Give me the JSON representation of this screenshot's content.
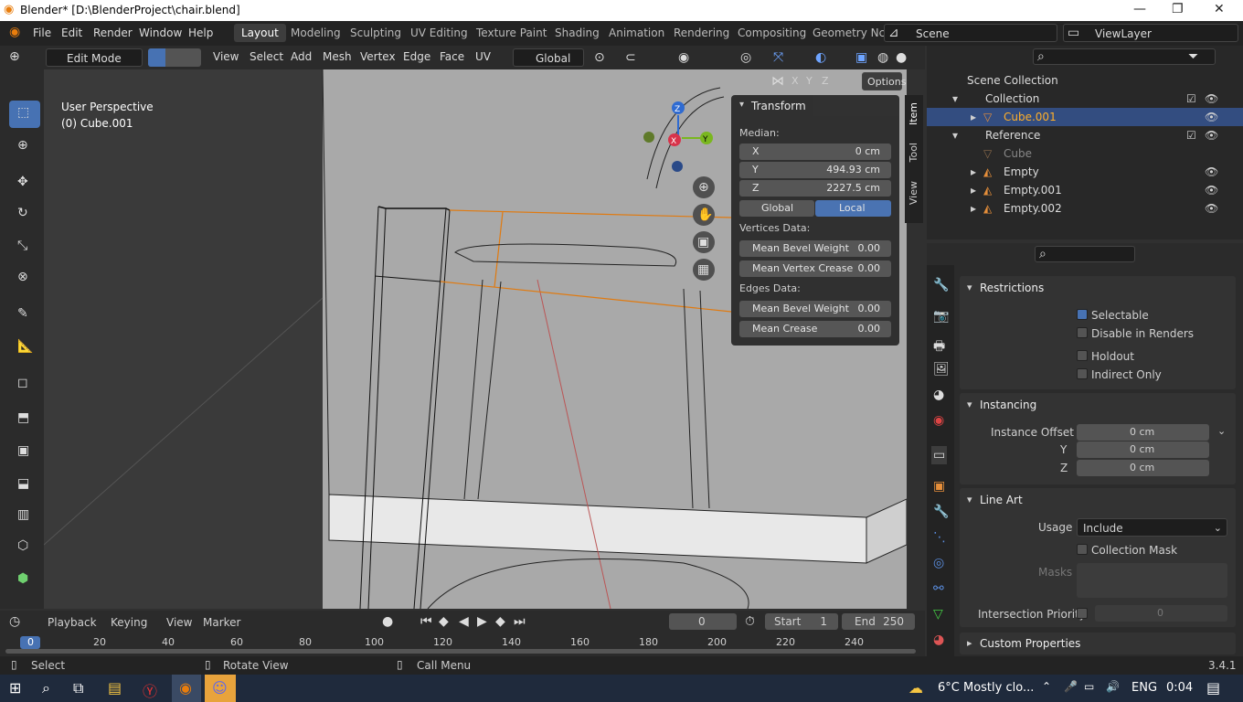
{
  "window": {
    "title": "Blender* [D:\\BlenderProject\\chair.blend]",
    "min": "—",
    "max": "❐",
    "close": "✕"
  },
  "menu": [
    "File",
    "Edit",
    "Render",
    "Window",
    "Help"
  ],
  "workspaces": [
    "Layout",
    "Modeling",
    "Sculpting",
    "UV Editing",
    "Texture Paint",
    "Shading",
    "Animation",
    "Rendering",
    "Compositing",
    "Geometry Nc"
  ],
  "scene": {
    "name": "Scene",
    "view_layer": "ViewLayer"
  },
  "header3d": {
    "mode": "Edit Mode",
    "menus": [
      "View",
      "Select",
      "Add",
      "Mesh",
      "Vertex",
      "Edge",
      "Face",
      "UV"
    ],
    "orientation": "Global",
    "axes": [
      "X",
      "Y",
      "Z"
    ],
    "options": "Options"
  },
  "viewport": {
    "perspective": "User Perspective",
    "object": "(0) Cube.001"
  },
  "gizmo": {
    "z": "Z",
    "x": "X",
    "y": "Y"
  },
  "npanel": {
    "title": "Transform",
    "median_label": "Median:",
    "x_label": "X",
    "x_value": "0 cm",
    "y_label": "Y",
    "y_value": "494.93 cm",
    "z_label": "Z",
    "z_value": "2227.5 cm",
    "global": "Global",
    "local": "Local",
    "vertices_label": "Vertices Data:",
    "mean_bevel_weight": "Mean Bevel Weight",
    "mbw_value": "0.00",
    "mean_vertex_crease": "Mean Vertex Crease",
    "mvc_value": "0.00",
    "edges_label": "Edges Data:",
    "mean_bevel_weight_e": "Mean Bevel Weight",
    "mbwe_value": "0.00",
    "mean_crease": "Mean Crease",
    "mc_value": "0.00",
    "tabs": [
      "Item",
      "Tool",
      "View"
    ]
  },
  "outliner": {
    "rows": [
      {
        "label": "Scene Collection"
      },
      {
        "label": "Collection"
      },
      {
        "label": "Cube.001"
      },
      {
        "label": "Reference"
      },
      {
        "label": "Cube"
      },
      {
        "label": "Empty"
      },
      {
        "label": "Empty.001"
      },
      {
        "label": "Empty.002"
      }
    ]
  },
  "properties": {
    "restrictions": "Restrictions",
    "selectable": "Selectable",
    "disable_renders": "Disable in Renders",
    "holdout": "Holdout",
    "indirect_only": "Indirect Only",
    "instancing": "Instancing",
    "instance_offset_x": "Instance Offset X",
    "io_x": "0 cm",
    "y_label": "Y",
    "io_y": "0 cm",
    "z_label": "Z",
    "io_z": "0 cm",
    "line_art": "Line Art",
    "usage_label": "Usage",
    "usage_value": "Include",
    "collection_mask": "Collection Mask",
    "masks": "Masks",
    "intersection_priority": "Intersection Priority",
    "ip_value": "0",
    "custom_props": "Custom Properties"
  },
  "timeline": {
    "menus": [
      "Playback",
      "Keying",
      "View",
      "Marker"
    ],
    "frame": "0",
    "start_label": "Start",
    "start": "1",
    "end_label": "End",
    "end": "250",
    "ticks": [
      "0",
      "20",
      "40",
      "60",
      "80",
      "100",
      "120",
      "140",
      "160",
      "180",
      "200",
      "220",
      "240"
    ]
  },
  "status": {
    "select": "Select",
    "rotate": "Rotate View",
    "call_menu": "Call Menu",
    "version": "3.4.1"
  },
  "taskbar": {
    "weather": "6°C  Mostly clo...",
    "lang": "ENG",
    "time": "0:04"
  }
}
